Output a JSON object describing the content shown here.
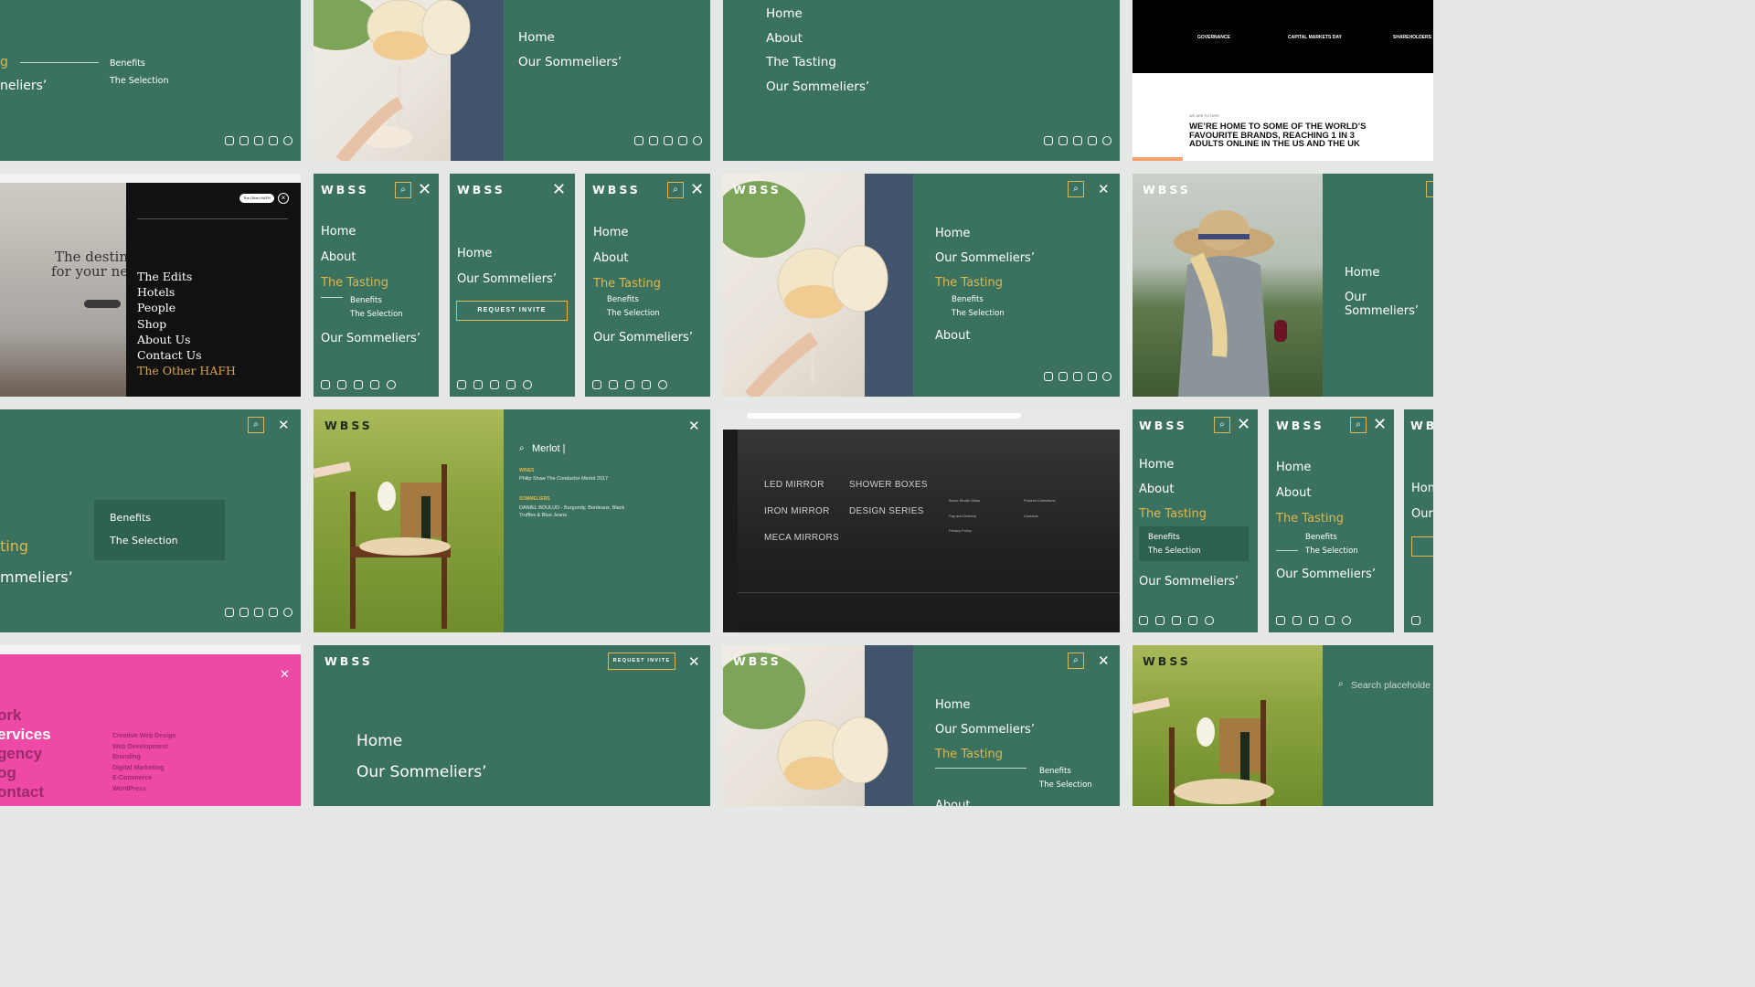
{
  "brand": {
    "logo": "WBSS",
    "gold": "#e0b64c",
    "green": "#3b725f"
  },
  "t1": {
    "partial1": "g",
    "partial2": "neliers’",
    "sub1": "Benefits",
    "sub2": "The Selection"
  },
  "t2": {
    "n1": "Home",
    "n2": "Our Sommeliers’"
  },
  "t3": {
    "n1": "Home",
    "n2": "About",
    "n3": "The Tasting",
    "n4": "Our Sommeliers’"
  },
  "t4": {
    "cols": [
      "GOVERNANCE",
      "CAPITAL MARKETS DAY",
      "SHAREHOLDERS"
    ],
    "kicker": "WE ARE FUTURE",
    "headline": "WE’RE HOME TO SOME OF THE WORLD’S FAVOURITE BRANDS, REACHING 1 IN 3 ADULTS ONLINE IN THE US AND THE UK"
  },
  "t5": {
    "hero1": "The destina",
    "hero2": "for your next",
    "pill": "The Other HAFH",
    "items": [
      "The Edits",
      "Hotels",
      "People",
      "Shop",
      "About Us",
      "Contact Us"
    ],
    "gold_item": "The Other HAFH"
  },
  "t6": {
    "n1": "Home",
    "n2": "About",
    "n3": "The Tasting",
    "s1": "Benefits",
    "s2": "The Selection",
    "n4": "Our Sommeliers’"
  },
  "t7": {
    "n1": "Home",
    "n2": "Our Sommeliers’",
    "btn": "REQUEST INVITE"
  },
  "t8": {
    "n1": "Home",
    "n2": "About",
    "n3": "The Tasting",
    "s1": "Benefits",
    "s2": "The Selection",
    "n4": "Our Sommeliers’"
  },
  "t9": {
    "n1": "Home",
    "n2": "Our Sommeliers’",
    "n3": "The Tasting",
    "s1": "Benefits",
    "s2": "The Selection",
    "n4": "About"
  },
  "t10": {
    "n1": "Home",
    "n2": "Our Sommeliers’"
  },
  "t11": {
    "s1": "Benefits",
    "s2": "The Selection",
    "p1": "ting",
    "p2": "mmeliers’"
  },
  "t12": {
    "query": "Merlot |",
    "h1": "WINES",
    "r1": "Philip Shaw The Conductor Merlot 2017",
    "h2": "SOMMELIERS",
    "r2": "DANIEL BOULUD - Burgundy, Bordeaux, Black Truffles & Blue Jeans"
  },
  "t13": {
    "menu": [
      "LED MIRROR",
      "SHOWER BOXES",
      "IRON MIRROR",
      "DESIGN SERIES",
      "MECA MIRRORS"
    ],
    "links1": [
      "About Studio Glass",
      "Pay and Delivery",
      "Privacy Policy"
    ],
    "links2": [
      "Product Collections",
      "Contacts"
    ]
  },
  "t14": {
    "n1": "Home",
    "n2": "About",
    "n3": "The Tasting",
    "s1": "Benefits",
    "s2": "The Selection",
    "n4": "Our Sommeliers’"
  },
  "t15": {
    "n1": "Home",
    "n2": "About",
    "n3": "The Tasting",
    "s1": "Benefits",
    "s2": "The Selection",
    "n4": "Our Sommeliers’"
  },
  "t16": {
    "n1": "Hon",
    "n2": "Our"
  },
  "t17": {
    "big": [
      "ork",
      "ervices",
      "gency",
      "og",
      "ontact"
    ],
    "list": [
      "Creative Web Design",
      "Web Development",
      "Branding",
      "Digital Marketing",
      "E-Commerce",
      "WordPress"
    ]
  },
  "t18": {
    "btn": "REQUEST INVITE",
    "n1": "Home",
    "n2": "Our Sommeliers’"
  },
  "t19": {
    "n1": "Home",
    "n2": "Our Sommeliers’",
    "n3": "The Tasting",
    "s1": "Benefits",
    "s2": "The Selection",
    "n4": "About"
  },
  "t20": {
    "search": "Search placeholde"
  }
}
